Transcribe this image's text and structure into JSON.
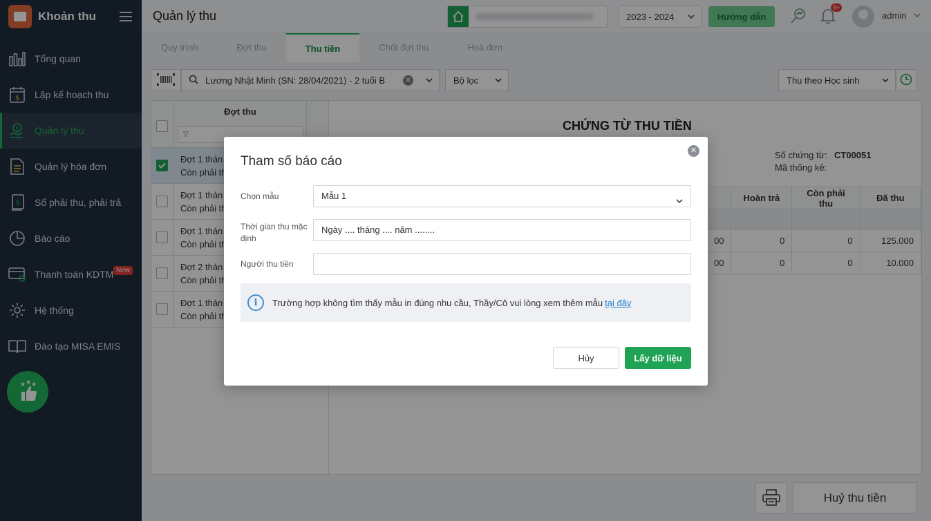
{
  "app": {
    "title": "Khoản thu"
  },
  "sidebar": {
    "items": [
      {
        "label": "Tổng quan",
        "icon": "bar-chart-icon"
      },
      {
        "label": "Lập kế hoạch thu",
        "icon": "calendar-money-icon"
      },
      {
        "label": "Quản lý thu",
        "icon": "money-hand-icon",
        "active": true
      },
      {
        "label": "Quản lý hóa đơn",
        "icon": "document-icon"
      },
      {
        "label": "Sổ phải thu, phải trả",
        "icon": "ledger-icon"
      },
      {
        "label": "Báo cáo",
        "icon": "pie-chart-icon"
      },
      {
        "label": "Thanh toán KDTM",
        "icon": "card-payment-icon",
        "badge": "New"
      },
      {
        "label": "Hệ thống",
        "icon": "gear-icon"
      },
      {
        "label": "Đào tạo MISA EMIS",
        "icon": "book-icon"
      }
    ]
  },
  "header": {
    "page_title": "Quản lý thu",
    "school_year": "2023 - 2024",
    "guide_label": "Hướng dẫn",
    "notif_count": "9+",
    "username": "admin"
  },
  "tabs": [
    "Quy trình",
    "Đợt thu",
    "Thu tiền",
    "Chốt đợt thu",
    "Hoá đơn"
  ],
  "active_tab": "Thu tiền",
  "filters": {
    "student_search": "Lương Nhật Minh (SN: 28/04/2021) - 2 tuổi B",
    "filter_label": "Bộ lọc",
    "mode": "Thu theo Học sinh"
  },
  "collection_list": {
    "header": "Đợt thu",
    "rows": [
      {
        "l1": "Đợt 1 thán",
        "l2": "Còn phải th",
        "checked": true
      },
      {
        "l1": "Đợt 1 thán",
        "l2": "Còn phải th",
        "checked": false
      },
      {
        "l1": "Đợt 1 thán",
        "l2": "Còn phải th",
        "checked": false
      },
      {
        "l1": "Đợt 2 thán",
        "l2": "Còn phải th",
        "checked": false
      },
      {
        "l1": "Đợt 1 thán",
        "l2": "Còn phải th",
        "checked": false
      }
    ]
  },
  "receipt": {
    "title": "CHỨNG TỪ THU TIỀN",
    "doc_no_label": "Số chứng từ:",
    "doc_no": "CT00051",
    "stat_code_label": "Mã thống kê:",
    "columns": [
      "Hoàn trả",
      "Còn phải thu",
      "Đã thu"
    ],
    "rows": [
      {
        "partial": "00",
        "refund": "0",
        "remaining": "0",
        "paid": "125.000"
      },
      {
        "partial": "00",
        "refund": "0",
        "remaining": "0",
        "paid": "10.000"
      }
    ]
  },
  "footer": {
    "cancel_collect_label": "Huỷ thu tiền"
  },
  "dialog": {
    "title": "Tham số báo cáo",
    "template_label": "Chọn mẫu",
    "template_value": "Mẫu 1",
    "default_time_label": "Thời gian thu mặc định",
    "default_time_value": "Ngày .... tháng .... năm ........",
    "collector_label": "Người thu tiền",
    "collector_value": "",
    "info_text": "Trường hợp không tìm thấy mẫu in đúng nhu cầu, Thầy/Cô vui lòng xem thêm mẫu",
    "info_link": "tại đây",
    "cancel_label": "Hủy",
    "ok_label": "Lấy dữ liệu"
  },
  "colors": {
    "accent": "#21a356",
    "sidebar_bg": "#1f2d3d",
    "link": "#1f7bc8",
    "badge": "#e23a3a"
  }
}
